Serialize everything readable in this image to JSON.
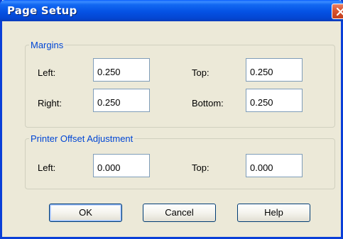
{
  "window": {
    "title": "Page Setup"
  },
  "margins": {
    "legend": "Margins",
    "left_label": "Left:",
    "left_value": "0.250",
    "top_label": "Top:",
    "top_value": "0.250",
    "right_label": "Right:",
    "right_value": "0.250",
    "bottom_label": "Bottom:",
    "bottom_value": "0.250"
  },
  "offset": {
    "legend": "Printer Offset Adjustment",
    "left_label": "Left:",
    "left_value": "0.000",
    "top_label": "Top:",
    "top_value": "0.000"
  },
  "buttons": {
    "ok": "OK",
    "cancel": "Cancel",
    "help": "Help"
  },
  "colors": {
    "titlebar": "#0552e4",
    "legend_text": "#0046d5",
    "dialog_bg": "#ece9d8",
    "close_button": "#d9532f"
  },
  "icons": {
    "close": "close-icon"
  }
}
